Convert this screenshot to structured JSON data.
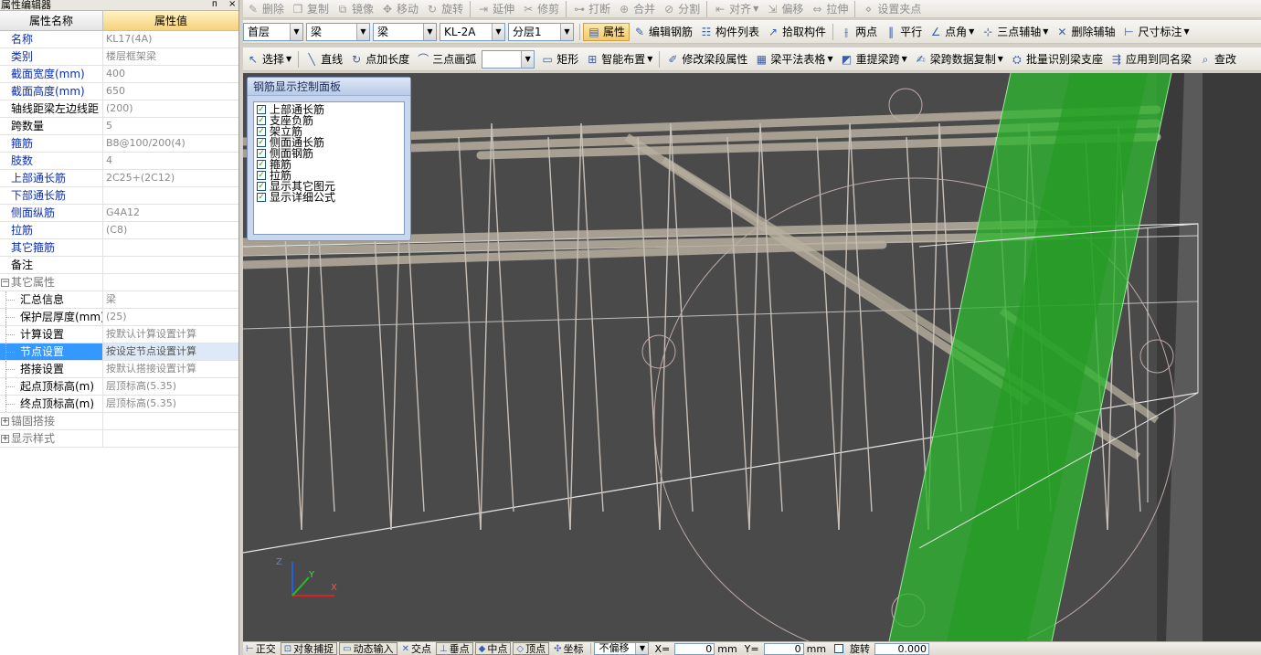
{
  "panel": {
    "title": "属性编辑器",
    "pin_glyph": "ᴨ",
    "close_glyph": "×",
    "col_name": "属性名称",
    "col_value": "属性值",
    "rows": [
      {
        "name": "名称",
        "value": "KL17(4A)",
        "style": "blue"
      },
      {
        "name": "类别",
        "value": "楼层框架梁",
        "style": "blue"
      },
      {
        "name": "截面宽度(mm)",
        "value": "400",
        "style": "blue"
      },
      {
        "name": "截面高度(mm)",
        "value": "650",
        "style": "blue"
      },
      {
        "name": "轴线距梁左边线距",
        "value": "(200)",
        "style": "black"
      },
      {
        "name": "跨数量",
        "value": "5",
        "style": "black"
      },
      {
        "name": "箍筋",
        "value": "B8@100/200(4)",
        "style": "blue"
      },
      {
        "name": "肢数",
        "value": "4",
        "style": "blue"
      },
      {
        "name": "上部通长筋",
        "value": "2C25+(2C12)",
        "style": "blue"
      },
      {
        "name": "下部通长筋",
        "value": "",
        "style": "blue"
      },
      {
        "name": "侧面纵筋",
        "value": "G4A12",
        "style": "blue"
      },
      {
        "name": "拉筋",
        "value": "(C8)",
        "style": "blue"
      },
      {
        "name": "其它箍筋",
        "value": "",
        "style": "blue"
      },
      {
        "name": "备注",
        "value": "",
        "style": "black"
      }
    ],
    "group_other": "其它属性",
    "other_rows": [
      {
        "name": "汇总信息",
        "value": "梁"
      },
      {
        "name": "保护层厚度(mm)",
        "value": "(25)"
      },
      {
        "name": "计算设置",
        "value": "按默认计算设置计算"
      },
      {
        "name": "节点设置",
        "value": "按设定节点设置计算",
        "selected": true
      },
      {
        "name": "搭接设置",
        "value": "按默认搭接设置计算"
      },
      {
        "name": "起点顶标高(m)",
        "value": "层顶标高(5.35)"
      },
      {
        "name": "终点顶标高(m)",
        "value": "层顶标高(5.35)"
      }
    ],
    "group_anchor": "锚固搭接",
    "group_display": "显示样式",
    "expander_minus": "−",
    "expander_plus": "+"
  },
  "toolbar1": {
    "items": [
      "删除",
      "复制",
      "镜像",
      "移动",
      "旋转",
      "延伸",
      "修剪",
      "打断",
      "合并",
      "分割",
      "对齐",
      "偏移",
      "拉伸",
      "设置夹点"
    ]
  },
  "toolbar2": {
    "floor": "首层",
    "category": "梁",
    "type": "梁",
    "component": "KL-2A",
    "layer": "分层1",
    "btn_property": "属性",
    "btn_edit_rebar": "编辑钢筋",
    "btn_component_list": "构件列表",
    "btn_pick": "拾取构件",
    "btn_two_points": "两点",
    "btn_parallel": "平行",
    "btn_point_angle": "点角",
    "btn_three_point_aux": "三点辅轴",
    "btn_delete_aux": "删除辅轴",
    "btn_dimension": "尺寸标注"
  },
  "toolbar3": {
    "btn_select": "选择",
    "btn_line": "直线",
    "btn_add_length": "点加长度",
    "btn_three_point_arc": "三点画弧",
    "btn_rect": "矩形",
    "btn_smart_layout": "智能布置",
    "btn_modify_span": "修改梁段属性",
    "btn_plan_table": "梁平法表格",
    "btn_reextract": "重提梁跨",
    "btn_span_copy": "梁跨数据复制",
    "btn_batch_identify": "批量识别梁支座",
    "btn_apply_same": "应用到同名梁",
    "btn_check": "查改"
  },
  "rebar_panel": {
    "title": "钢筋显示控制面板",
    "check_glyph": "✓",
    "items": [
      "上部通长筋",
      "支座负筋",
      "架立筋",
      "侧面通长筋",
      "侧面钢筋",
      "箍筋",
      "拉筋",
      "显示其它图元",
      "显示详细公式"
    ]
  },
  "axes": {
    "x": "X",
    "y": "Y",
    "z": "Z"
  },
  "statusbar": {
    "ortho": "正交",
    "osnap": "对象捕捉",
    "dynamic_input": "动态输入",
    "intersection": "交点",
    "perpendicular": "垂点",
    "midpoint": "中点",
    "vertex": "顶点",
    "coordinate": "坐标",
    "offset_mode": "不偏移",
    "x_label": "X=",
    "x_value": "0",
    "y_label": "Y=",
    "y_value": "0",
    "unit": "mm",
    "rotate_label": "旋转",
    "rotate_value": "0.000"
  },
  "colors": {
    "viewport_bg": "#4a4a4a",
    "column_green": "#2fb52f",
    "rebar": "#b8b09f",
    "selected_row": "#3399ff"
  }
}
